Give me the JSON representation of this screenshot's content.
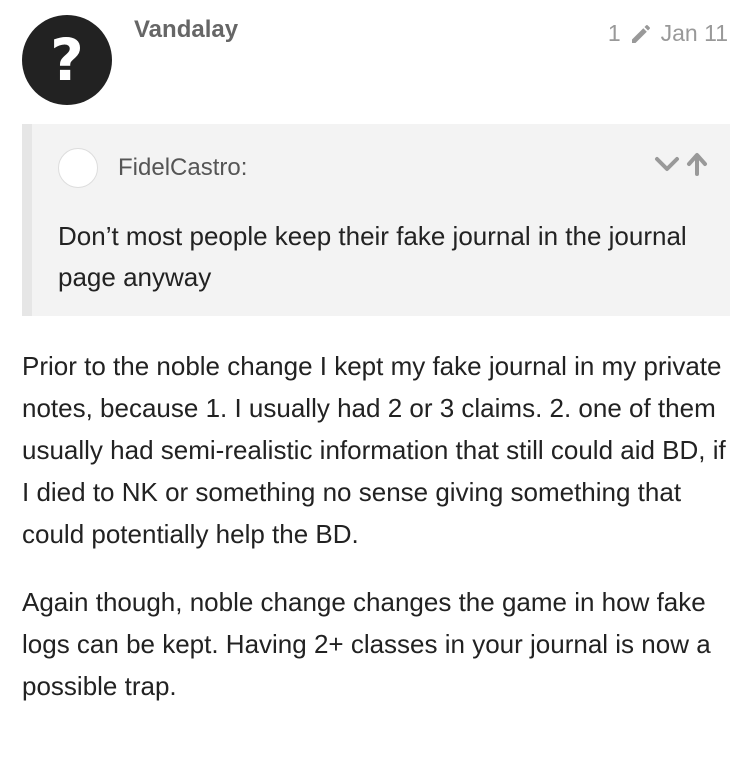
{
  "post": {
    "avatar_letter": "?",
    "username": "Vandalay",
    "edit_count": "1",
    "date": "Jan 11"
  },
  "quote": {
    "author": "FidelCastro:",
    "text": "Don’t most people keep their fake journal in the journal page anyway"
  },
  "body": {
    "paragraphs": [
      "Prior to the noble change I kept my fake journal in my private notes, because 1. I usually had 2 or 3 claims. 2. one of them usually had semi-realistic information that still could aid BD, if I died to NK or something no sense giving something that could potentially help the BD.",
      "Again though, noble change changes the game in how fake logs can be kept. Having 2+ classes in your journal is now a possible trap."
    ]
  },
  "icons": {
    "edit": "pencil-icon",
    "expand": "chevron-down-icon",
    "jump": "arrow-up-icon"
  },
  "colors": {
    "avatar_bg": "#222222",
    "quote_bg": "#f3f3f3",
    "meta": "#999999"
  }
}
